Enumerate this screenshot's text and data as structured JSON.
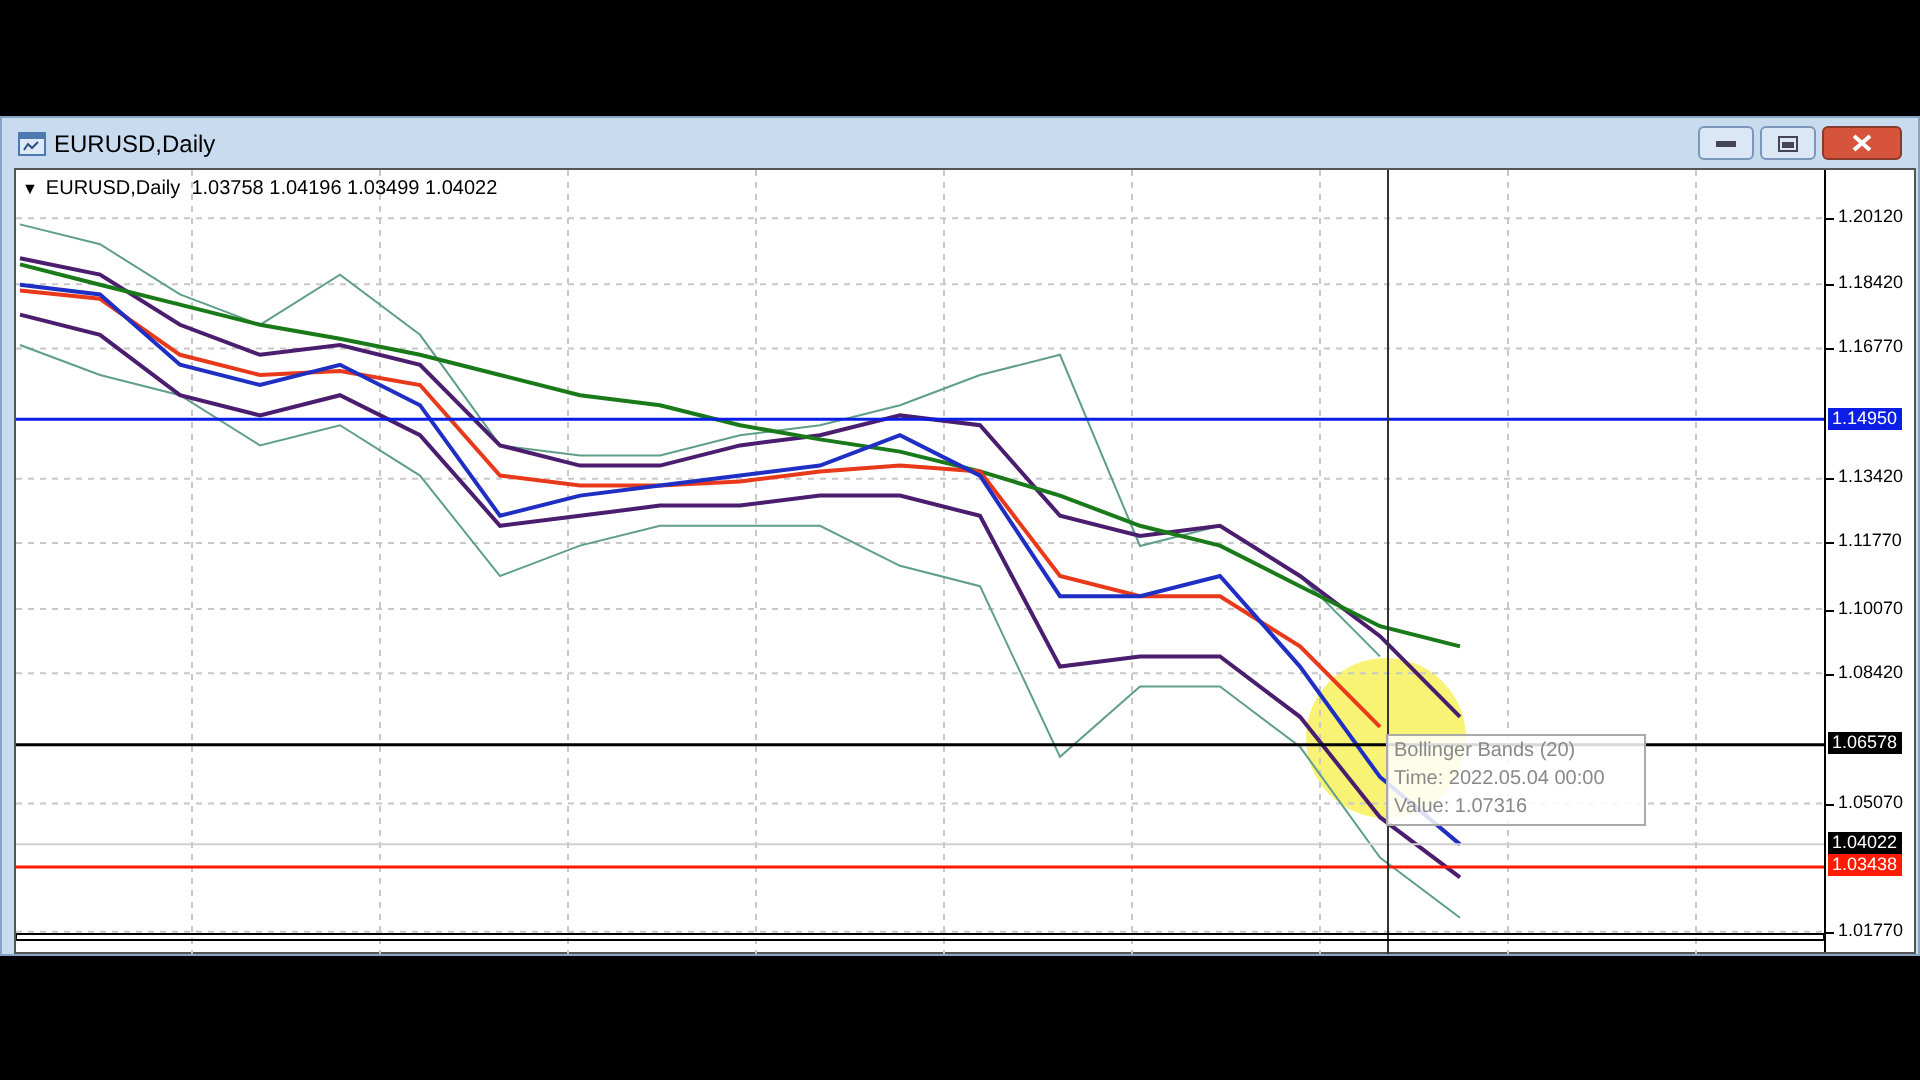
{
  "window": {
    "title": "EURUSD,Daily"
  },
  "chart": {
    "menu_glyph": "▼",
    "header": "EURUSD,Daily  1.03758 1.04196 1.03499 1.04022",
    "chart_data": {
      "type": "line",
      "categories": [
        null,
        null,
        null,
        null,
        null,
        null,
        null,
        null,
        null,
        null,
        null,
        null,
        null,
        null,
        null,
        null,
        null,
        null,
        null
      ],
      "ylim": [
        1.012,
        1.2136
      ],
      "grid": true,
      "ref_lines": [
        {
          "axis": "y",
          "value": 1.1495,
          "label": "1.14950",
          "color": "#0a1ee6"
        },
        {
          "axis": "y",
          "value": 1.06578,
          "label": "1.06578",
          "color": "#000000"
        },
        {
          "axis": "y",
          "value": 1.04022,
          "label": "1.04022",
          "color": "#d0d0d0"
        },
        {
          "axis": "y",
          "value": 1.03438,
          "label": "1.03438",
          "color": "#ff1a00"
        }
      ],
      "yticks": [
        {
          "value": 1.2012,
          "label": "1.20120"
        },
        {
          "value": 1.1842,
          "label": "1.18420"
        },
        {
          "value": 1.1677,
          "label": "1.16770"
        },
        {
          "value": 1.1342,
          "label": "1.13420"
        },
        {
          "value": 1.1177,
          "label": "1.11770"
        },
        {
          "value": 1.1007,
          "label": "1.10070"
        },
        {
          "value": 1.0842,
          "label": "1.08420"
        },
        {
          "value": 1.0507,
          "label": "1.05070"
        },
        {
          "value": 1.0177,
          "label": "1.01770"
        }
      ],
      "series": [
        {
          "color": "#5f9e8a",
          "values": [
            1.1996,
            1.1945,
            1.1816,
            1.1738,
            1.1867,
            1.1712,
            1.1428,
            1.1402,
            1.1402,
            1.1454,
            1.148,
            1.1531,
            1.1609,
            1.1661,
            1.1169,
            1.1221,
            1.1092,
            1.0885,
            null
          ]
        },
        {
          "color": "#5f9e8a",
          "values": [
            1.1686,
            1.1609,
            1.1557,
            1.1428,
            1.148,
            1.135,
            1.1092,
            1.117,
            1.1221,
            1.1221,
            1.1221,
            1.1118,
            1.1066,
            1.0627,
            1.0808,
            1.0808,
            1.0653,
            1.0368,
            1.0213
          ]
        },
        {
          "color": "#4b1d6e",
          "values": [
            1.1909,
            1.1867,
            1.1738,
            1.1661,
            1.1686,
            1.1635,
            1.1428,
            1.1376,
            1.1376,
            1.1428,
            1.1454,
            1.1505,
            1.148,
            1.1247,
            1.1195,
            1.1221,
            1.1092,
            1.0937,
            1.073
          ]
        },
        {
          "color": "#4b1d6e",
          "values": [
            1.1764,
            1.1712,
            1.1557,
            1.1505,
            1.1557,
            1.1454,
            1.1221,
            1.1247,
            1.1273,
            1.1273,
            1.1299,
            1.1299,
            1.1247,
            1.0859,
            1.0885,
            1.0885,
            1.073,
            1.0472,
            1.0317
          ]
        },
        {
          "color": "#1a7a1a",
          "values": [
            1.1893,
            1.1841,
            1.179,
            1.1738,
            1.1702,
            1.1661,
            1.1609,
            1.1557,
            1.1531,
            1.148,
            1.1443,
            1.1412,
            1.1361,
            1.1299,
            1.1221,
            1.117,
            1.1066,
            1.0963,
            1.0911
          ]
        },
        {
          "color": "#e83a1a",
          "values": [
            1.1826,
            1.1805,
            1.1661,
            1.1609,
            1.1619,
            1.1583,
            1.135,
            1.1325,
            1.1325,
            1.1335,
            1.1361,
            1.1376,
            1.1361,
            1.1092,
            1.104,
            1.104,
            1.0911,
            1.0704,
            null
          ]
        },
        {
          "color": "#1f2fc4",
          "values": [
            1.1841,
            1.1816,
            1.1635,
            1.1583,
            1.1635,
            1.1531,
            1.1247,
            1.1299,
            1.1325,
            1.135,
            1.1376,
            1.1454,
            1.135,
            1.104,
            1.104,
            1.1092,
            1.0859,
            1.0575,
            1.0402
          ]
        }
      ]
    },
    "tooltip": {
      "lines": [
        "Bollinger Bands (20)",
        "Time: 2022.05.04 00:00",
        "Value: 1.07316"
      ]
    }
  }
}
